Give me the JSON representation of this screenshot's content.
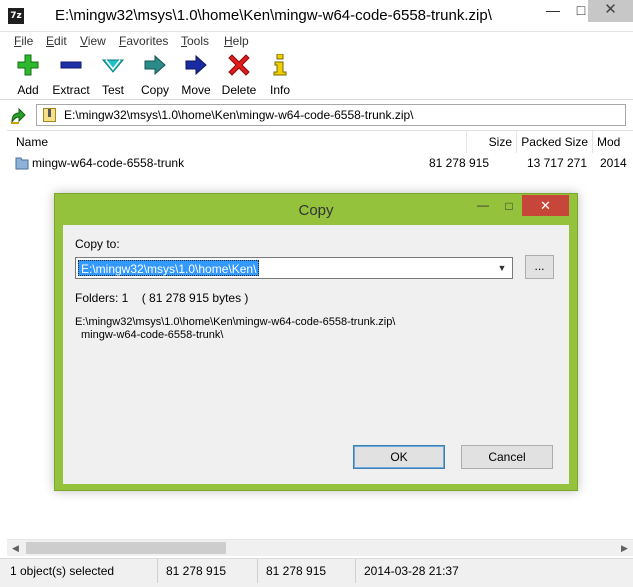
{
  "window": {
    "app_icon_text": "7z",
    "title": "E:\\mingw32\\msys\\1.0\\home\\Ken\\mingw-w64-code-6558-trunk.zip\\"
  },
  "menu": [
    {
      "first": "F",
      "rest": "ile"
    },
    {
      "first": "E",
      "rest": "dit"
    },
    {
      "first": "V",
      "rest": "iew"
    },
    {
      "first": "F",
      "rest": "avorites"
    },
    {
      "first": "T",
      "rest": "ools"
    },
    {
      "first": "H",
      "rest": "elp"
    }
  ],
  "toolbar": {
    "add": "Add",
    "extract": "Extract",
    "test": "Test",
    "copy": "Copy",
    "move": "Move",
    "delete": "Delete",
    "info": "Info",
    "colors": {
      "add": "#2db82d",
      "extract": "#1f2fa8",
      "test": "#1fc0c8",
      "copy": "#2b8a8a",
      "move": "#1a2aa0",
      "delete": "#e01c1c",
      "info": "#d4b400"
    }
  },
  "address": {
    "path": "E:\\mingw32\\msys\\1.0\\home\\Ken\\mingw-w64-code-6558-trunk.zip\\"
  },
  "list": {
    "columns": {
      "name": "Name",
      "size": "Size",
      "packed": "Packed Size",
      "modified": "Mod"
    },
    "rows": [
      {
        "name": "mingw-w64-code-6558-trunk",
        "size": "81 278 915",
        "packed": "13 717 271",
        "modified": "2014"
      }
    ]
  },
  "status": {
    "selected": "1 object(s) selected",
    "size": "81 278 915",
    "packed": "81 278 915",
    "modified": "2014-03-28 21:37"
  },
  "dialog": {
    "title": "Copy",
    "copy_to_label": "Copy to:",
    "destination": "E:\\mingw32\\msys\\1.0\\home\\Ken\\",
    "browse": "...",
    "folders_info": "Folders: 1    ( 81 278 915 bytes )",
    "source_line1": "E:\\mingw32\\msys\\1.0\\home\\Ken\\mingw-w64-code-6558-trunk.zip\\",
    "source_line2": "mingw-w64-code-6558-trunk\\",
    "ok": "OK",
    "cancel": "Cancel",
    "frame_color": "#94c23d",
    "close_color": "#c7463a"
  }
}
